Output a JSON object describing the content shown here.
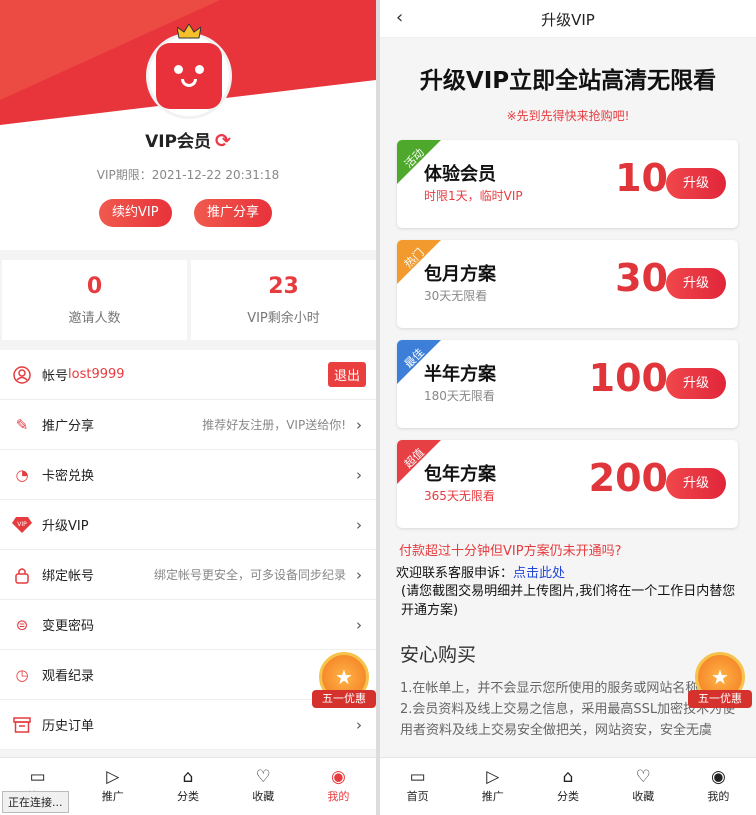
{
  "profile": {
    "title": "VIP会员",
    "expire": "VIP期限：2021-12-22 20:31:18",
    "renew_label": "续约VIP",
    "share_label": "推广分享",
    "stats": [
      {
        "value": "0",
        "label": "邀请人数"
      },
      {
        "value": "23",
        "label": "VIP剩余小时"
      }
    ]
  },
  "menu": {
    "account_prefix": "帐号",
    "account_user": "lost9999",
    "logout": "退出",
    "items": [
      {
        "label": "推广分享",
        "hint": "推荐好友注册，VIP送给你!"
      },
      {
        "label": "卡密兑换",
        "hint": ""
      },
      {
        "label": "升级VIP",
        "hint": ""
      },
      {
        "label": "绑定帐号",
        "hint": "绑定帐号更安全，可多设备同步纪录"
      },
      {
        "label": "变更密码",
        "hint": ""
      },
      {
        "label": "观看纪录",
        "hint": ""
      },
      {
        "label": "历史订单",
        "hint": ""
      }
    ]
  },
  "promo_badge": "五一优惠",
  "left_tabs": [
    "首页",
    "推广",
    "分类",
    "收藏",
    "我的"
  ],
  "status_text": "正在连接...",
  "upgrade": {
    "nav_title": "升级VIP",
    "headline": "升级VIP立即全站高清无限看",
    "subline": "※先到先得快来抢购吧!",
    "button": "升级",
    "plans": [
      {
        "tag": "活动",
        "tag_color": "#4ea82c",
        "name": "体验会员",
        "desc": "时限1天，临时VIP",
        "price": "10"
      },
      {
        "tag": "热门",
        "tag_color": "#f29a2e",
        "name": "包月方案",
        "desc": "30天无限看",
        "price": "30"
      },
      {
        "tag": "最佳",
        "tag_color": "#3d7fd8",
        "name": "半年方案",
        "desc": "180天无限看",
        "price": "100"
      },
      {
        "tag": "超值",
        "tag_color": "#e64045",
        "name": "包年方案",
        "desc": "365天无限看",
        "price": "200"
      }
    ],
    "notice": "付款超过十分钟但VIP方案仍未开通吗?",
    "contact_prefix": "欢迎联系客服申诉：",
    "contact_link": "点击此处",
    "note": "(请您截图交易明细并上传图片,我们将在一个工作日内替您开通方案)",
    "secure_title": "安心购买",
    "secure_lines": [
      "1.在帐单上，并不会显示您所使用的服务或网站名称。",
      "2.会员资料及线上交易之信息，采用最高SSL加密技术为使用者资料及线上交易安全做把关，网站资安，安全无虞"
    ]
  },
  "right_tabs": [
    "首页",
    "推广",
    "分类",
    "收藏",
    "我的"
  ],
  "colors": {
    "accent": "#e63b3f"
  }
}
